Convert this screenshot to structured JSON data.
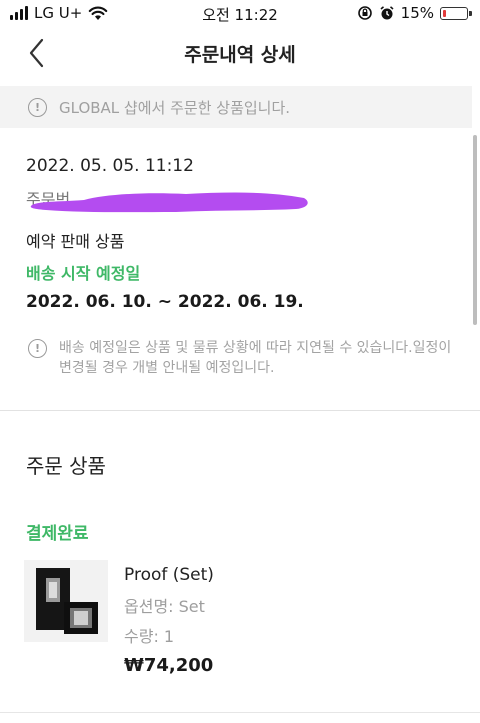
{
  "status_bar": {
    "carrier": "LG U+",
    "time": "오전 11:22",
    "battery_percent_text": "15%",
    "battery_level": 0.15,
    "battery_color": "#e23b3b"
  },
  "header": {
    "title": "주문내역 상세",
    "back_icon": "chevron-left-icon"
  },
  "notice": {
    "text": "GLOBAL 샵에서 주문한 상품입니다.",
    "icon": "info-icon"
  },
  "order": {
    "datetime": "2022. 05. 05. 11:12",
    "number_label": "주문번",
    "redaction_color": "#b44cf0",
    "sale_type": "예약 판매 상품",
    "shipping_label": "배송 시작 예정일",
    "shipping_range": "2022. 06. 10. ~ 2022. 06. 19.",
    "shipping_note": "배송 예정일은 상품 및 물류 상황에 따라 지연될 수 있습니다.일정이 변경될 경우 개별 안내될 예정입니다."
  },
  "products_section": {
    "title": "주문 상품",
    "status": "결제완료",
    "items": [
      {
        "name": "Proof (Set)",
        "option": "옵션명: Set",
        "quantity": "수량: 1",
        "price": "₩74,200"
      }
    ]
  },
  "colors": {
    "accent_green": "#3fb867",
    "muted_text": "#a0a0a0",
    "banner_bg": "#f3f3f3"
  }
}
